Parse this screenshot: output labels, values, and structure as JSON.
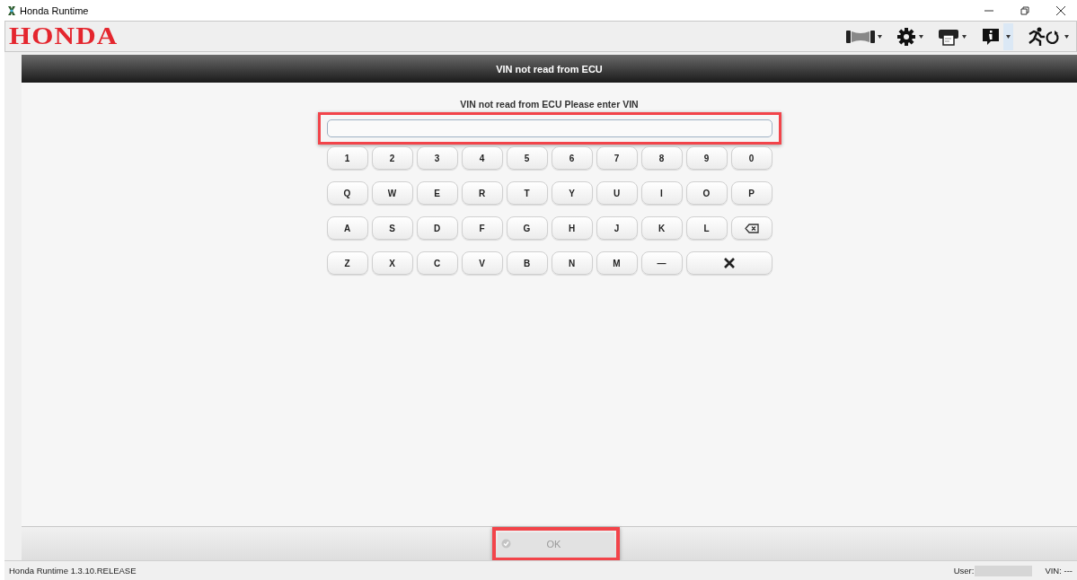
{
  "window": {
    "title": "Honda Runtime"
  },
  "logo": {
    "text": "HONDA"
  },
  "dialog": {
    "title": "VIN not read from ECU",
    "prompt": "VIN not read from ECU Please enter VIN",
    "vin_field": {
      "highlighted": true
    },
    "keyboard": [
      [
        {
          "kind": "char",
          "label": "1"
        },
        {
          "kind": "char",
          "label": "2"
        },
        {
          "kind": "char",
          "label": "3"
        },
        {
          "kind": "char",
          "label": "4"
        },
        {
          "kind": "char",
          "label": "5"
        },
        {
          "kind": "char",
          "label": "6"
        },
        {
          "kind": "char",
          "label": "7"
        },
        {
          "kind": "char",
          "label": "8"
        },
        {
          "kind": "char",
          "label": "9"
        },
        {
          "kind": "char",
          "label": "0"
        }
      ],
      [
        {
          "kind": "char",
          "label": "Q"
        },
        {
          "kind": "char",
          "label": "W"
        },
        {
          "kind": "char",
          "label": "E"
        },
        {
          "kind": "char",
          "label": "R"
        },
        {
          "kind": "char",
          "label": "T"
        },
        {
          "kind": "char",
          "label": "Y"
        },
        {
          "kind": "char",
          "label": "U"
        },
        {
          "kind": "char",
          "label": "I"
        },
        {
          "kind": "char",
          "label": "O"
        },
        {
          "kind": "char",
          "label": "P"
        }
      ],
      [
        {
          "kind": "char",
          "label": "A"
        },
        {
          "kind": "char",
          "label": "S"
        },
        {
          "kind": "char",
          "label": "D"
        },
        {
          "kind": "char",
          "label": "F"
        },
        {
          "kind": "char",
          "label": "G"
        },
        {
          "kind": "char",
          "label": "H"
        },
        {
          "kind": "char",
          "label": "J"
        },
        {
          "kind": "char",
          "label": "K"
        },
        {
          "kind": "char",
          "label": "L"
        },
        {
          "kind": "backspace"
        }
      ],
      [
        {
          "kind": "char",
          "label": "Z"
        },
        {
          "kind": "char",
          "label": "X"
        },
        {
          "kind": "char",
          "label": "C"
        },
        {
          "kind": "char",
          "label": "V"
        },
        {
          "kind": "char",
          "label": "B"
        },
        {
          "kind": "char",
          "label": "N"
        },
        {
          "kind": "char",
          "label": "M"
        },
        {
          "kind": "char",
          "label": "—"
        },
        {
          "kind": "clear"
        }
      ]
    ],
    "ok_button": {
      "label": "OK",
      "disabled": true,
      "highlighted": true
    }
  },
  "status_bar": {
    "version": "Honda Runtime 1.3.10.RELEASE",
    "user_label": "User:",
    "vin_label": "VIN: ---"
  }
}
